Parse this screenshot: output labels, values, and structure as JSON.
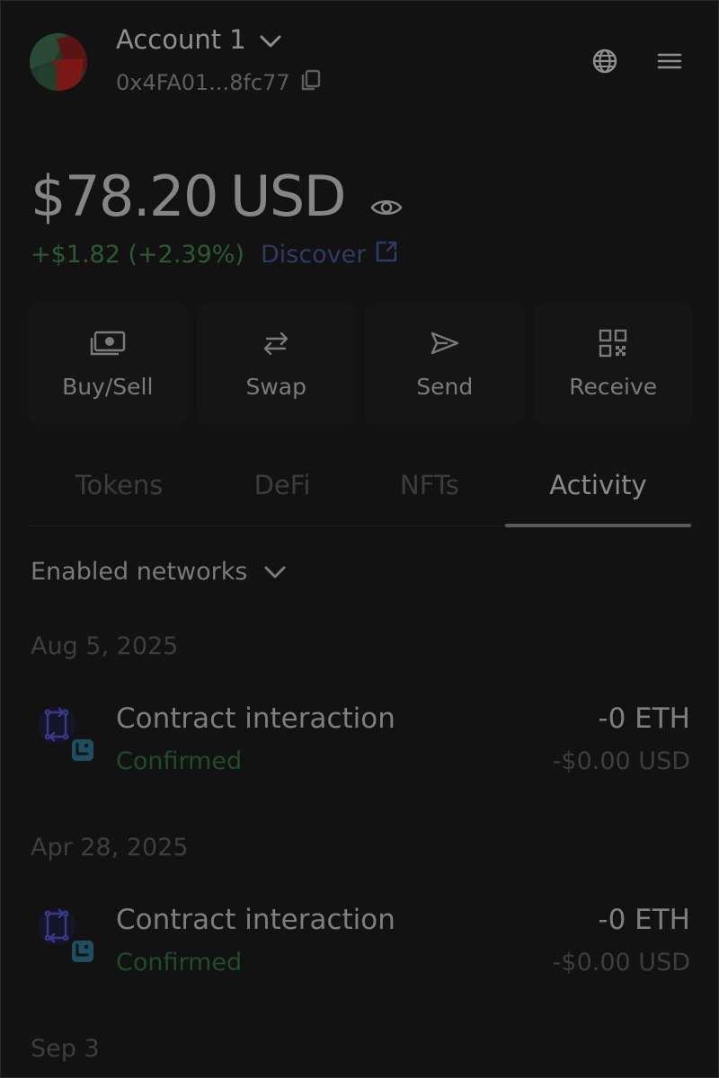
{
  "header": {
    "account_name": "Account 1",
    "account_address": "0x4FA01...8fc77",
    "icons": {
      "account_dropdown": "chevron-down-icon",
      "copy": "copy-icon",
      "network": "globe-icon",
      "menu": "hamburger-menu-icon"
    }
  },
  "balance": {
    "amount": "$78.20",
    "currency": "USD",
    "change": "+$1.82 (+2.39%)",
    "discover_label": "Discover",
    "icons": {
      "visibility": "eye-icon",
      "external_link": "external-link-icon"
    }
  },
  "actions": [
    {
      "label": "Buy/Sell",
      "icon": "cash-icon"
    },
    {
      "label": "Swap",
      "icon": "swap-arrows-icon"
    },
    {
      "label": "Send",
      "icon": "send-arrow-icon"
    },
    {
      "label": "Receive",
      "icon": "qr-code-icon"
    }
  ],
  "tabs": [
    {
      "label": "Tokens",
      "active": false
    },
    {
      "label": "DeFi",
      "active": false
    },
    {
      "label": "NFTs",
      "active": false
    },
    {
      "label": "Activity",
      "active": true
    }
  ],
  "activity": {
    "networks_filter": "Enabled networks",
    "groups": [
      {
        "date": "Aug 5, 2025",
        "transactions": [
          {
            "title": "Contract interaction",
            "status": "Confirmed",
            "amount": "-0 ETH",
            "fiat": "-$0.00 USD"
          }
        ]
      },
      {
        "date": "Apr 28, 2025",
        "transactions": [
          {
            "title": "Contract interaction",
            "status": "Confirmed",
            "amount": "-0 ETH",
            "fiat": "-$0.00 USD"
          }
        ]
      },
      {
        "date": "Sep 3",
        "transactions": []
      }
    ]
  },
  "colors": {
    "background": "#121212",
    "positive_change": "#2b5b31",
    "confirmed": "#224b29",
    "link": "#2f3b66",
    "active_tab_underline": "#5a5a5a"
  }
}
